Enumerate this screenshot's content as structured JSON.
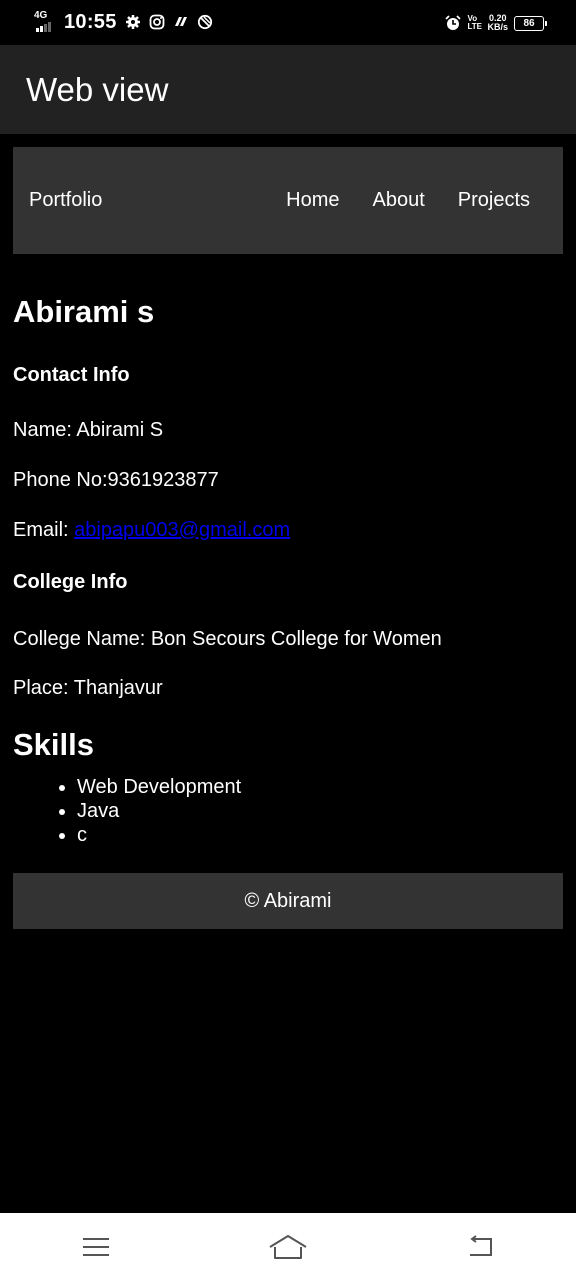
{
  "status_bar": {
    "network": "4G",
    "time": "10:55",
    "volte": "VoLTE",
    "speed_value": "0.20",
    "speed_unit": "KB/s",
    "battery": "86"
  },
  "app_bar": {
    "title": "Web view"
  },
  "web": {
    "navbar": {
      "brand": "Portfolio",
      "links": [
        "Home",
        "About",
        "Projects"
      ]
    },
    "heading": "Abirami s",
    "contact": {
      "title": "Contact Info",
      "name": "Name: Abirami S",
      "phone": "Phone No:9361923877",
      "email_label": "Email: ",
      "email_link": "abipapu003@gmail.com"
    },
    "college": {
      "title": "College Info",
      "college_name": "College Name: Bon Secours College for Women",
      "place": "Place: Thanjavur"
    },
    "skills": {
      "title": "Skills",
      "items": [
        "Web Development",
        "Java",
        "c"
      ]
    },
    "footer": "© Abirami"
  },
  "colors": {
    "background": "#000000",
    "app_bar": "#222222",
    "navbar": "#333333",
    "link": "#0000ee"
  }
}
